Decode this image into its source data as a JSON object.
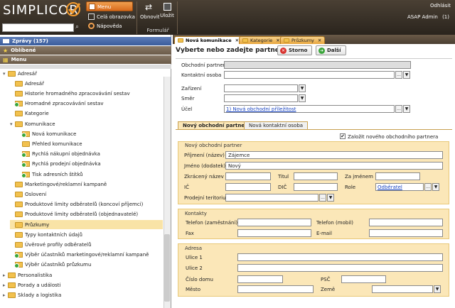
{
  "top": {
    "logo": "SIMPLICOR",
    "menu": "Menu",
    "full_screen": "Celá obrazovka",
    "help": "Nápověda",
    "refresh": "Obnovit",
    "save": "Uložit",
    "formular": "Formulář",
    "logout": "Odhlásit",
    "user": "ASAP Admin",
    "user_count": "(1)"
  },
  "sidebar": {
    "messages": "Zprávy (157)",
    "favorites": "Oblíbené",
    "menu": "Menu",
    "items": [
      {
        "label": "Adresář",
        "level": 0,
        "exp": true
      },
      {
        "label": "Adresář",
        "level": 1
      },
      {
        "label": "Historie hromadného zpracovávání sestav",
        "level": 1
      },
      {
        "label": "Hromadné zpracovávání sestav",
        "level": 1,
        "g": true
      },
      {
        "label": "Kategorie",
        "level": 1
      },
      {
        "label": "Komunikace",
        "level": 1,
        "exp": true
      },
      {
        "label": "Nová komunikace",
        "level": 2,
        "g": true
      },
      {
        "label": "Přehled komunikace",
        "level": 2
      },
      {
        "label": "Rychlá nákupní objednávka",
        "level": 2,
        "g": true
      },
      {
        "label": "Rychlá prodejní objednávka",
        "level": 2,
        "g": true
      },
      {
        "label": "Tisk adresních štítků",
        "level": 2,
        "g": true
      },
      {
        "label": "Marketingové/reklamní kampaně",
        "level": 1
      },
      {
        "label": "Oslovení",
        "level": 1
      },
      {
        "label": "Produktové limity odběratelů (koncoví příjemci)",
        "level": 1
      },
      {
        "label": "Produktové limity odběratelů (objednavatelé)",
        "level": 1
      },
      {
        "label": "Průzkumy",
        "level": 1,
        "sel": true
      },
      {
        "label": "Typy kontaktních údajů",
        "level": 1
      },
      {
        "label": "Úvěrové profily odběratelů",
        "level": 1
      },
      {
        "label": "Výběr účastníků marketingové/reklamní kampaně",
        "level": 1,
        "g": true
      },
      {
        "label": "Výběr účastníků průzkumu",
        "level": 1,
        "g": true
      },
      {
        "label": "Personalistika",
        "level": 0
      },
      {
        "label": "Porady a události",
        "level": 0
      },
      {
        "label": "Sklady a logistika",
        "level": 0
      }
    ]
  },
  "tabs": [
    "Nová komunikace",
    "Kategorie",
    "Průzkumy"
  ],
  "form": {
    "title": "Vyberte nebo zadejte partnera",
    "cancel": "Storno",
    "next": "Další",
    "partner_lbl": "Obchodní partner",
    "contact_lbl": "Kontaktní osoba",
    "device_lbl": "Zařízení",
    "direction_lbl": "Směr",
    "purpose_lbl": "Účel",
    "purpose_val": "1) Nová obchodní příležitost",
    "ellipsis": "...",
    "subtab_new_partner": "Nový obchodní partner",
    "subtab_new_contact": "Nová kontaktní osoba",
    "create_new_lbl": "Založit nového obchodního partnera",
    "sec_partner": "Nový obchodní partner",
    "surname_lbl": "Příjmení (název)",
    "surname_val": "Zájemce",
    "firstname_lbl": "Jméno (dodatek)",
    "firstname_val": "Nový",
    "short_lbl": "Zkrácený název",
    "title_lbl": "Titul",
    "after_lbl": "Za jménem",
    "ic_lbl": "IČ",
    "dic_lbl": "DIČ",
    "role_lbl": "Role",
    "role_val": "Odběratel",
    "territory_lbl": "Prodejní teritorium",
    "sec_contacts": "Kontakty",
    "phone_work_lbl": "Telefon (zaměstnání)",
    "phone_mobile_lbl": "Telefon (mobil)",
    "fax_lbl": "Fax",
    "email_lbl": "E-mail",
    "sec_address": "Adresa",
    "street1_lbl": "Ulice 1",
    "street2_lbl": "Ulice 2",
    "house_lbl": "Číslo domu",
    "zip_lbl": "PSČ",
    "city_lbl": "Město",
    "country_lbl": "Země"
  }
}
